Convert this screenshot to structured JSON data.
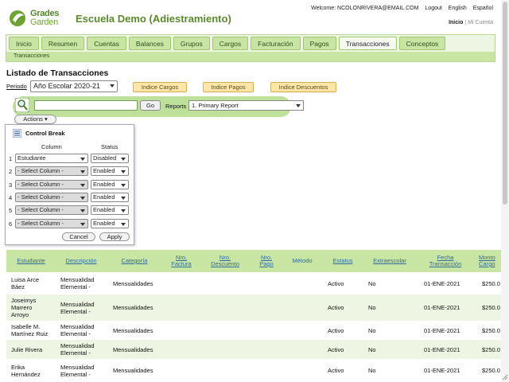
{
  "brand": {
    "line1": "Grades",
    "line2": "Garden",
    "colors": {
      "green": "#5a8a2a",
      "light_green": "#c9e5a4"
    }
  },
  "school_name": "Escuela Demo (Adiestramiento)",
  "top_links": {
    "welcome": "Welcome: NCOLONRIVERA@EMAIL.COM",
    "logout": "Logout",
    "english": "English",
    "espanol": "Español"
  },
  "account_links": {
    "inicio": "Inicio",
    "separator": "|",
    "mi_cuenta": "Mi Cuenta"
  },
  "tabs": [
    "Inicio",
    "Resumen",
    "Cuentas",
    "Balances",
    "Grupos",
    "Cargos",
    "Facturación",
    "Pagos",
    "Transacciones",
    "Conceptos"
  ],
  "active_tab": "Transacciones",
  "subnav": "Transacciones",
  "page_title": "Listado de Transacciones",
  "period": {
    "label": "Periodo",
    "value": "Año Escolar 2020-21"
  },
  "index_buttons": {
    "cargos": "Indice Cargos",
    "pagos": "Indice Pagos",
    "descuentos": "Indice Descuentos"
  },
  "search": {
    "go": "Go",
    "reports_label": "Reports",
    "report_selected": "1. Primary Report"
  },
  "actions_label": "Actions",
  "control_break": {
    "title": "Control Break",
    "column_header": "Column",
    "status_header": "Status",
    "rows": [
      {
        "num": "1",
        "column": "Estudiante",
        "status": "Disabled"
      },
      {
        "num": "2",
        "column": "- Select Column -",
        "status": "Enabled"
      },
      {
        "num": "3",
        "column": "- Select Column -",
        "status": "Enabled"
      },
      {
        "num": "4",
        "column": "- Select Column -",
        "status": "Enabled"
      },
      {
        "num": "5",
        "column": "- Select Column -",
        "status": "Enabled"
      },
      {
        "num": "6",
        "column": "- Select Column -",
        "status": "Enabled"
      }
    ],
    "cancel": "Cancel",
    "apply": "Apply"
  },
  "table": {
    "headers": {
      "estudiante": "Estudiante",
      "descripcion": "Descripción",
      "categoria": "Categoría",
      "nro_factura": [
        "Nro.",
        "Factura"
      ],
      "nro_descuento": [
        "Nro.",
        "Descuento"
      ],
      "nro_pago": [
        "Nro.",
        "Pago"
      ],
      "metodo": "Método",
      "estatus": "Estatus",
      "extraescolar": "Extraescolar",
      "fecha": [
        "Fecha",
        "Transacción"
      ],
      "monto": [
        "Monto",
        "Cargo"
      ]
    },
    "rows": [
      {
        "estudiante": [
          "Luisa Arce",
          "Báez"
        ],
        "descripcion": [
          "Mensualidad",
          "Elemental -"
        ],
        "categoria": "Mensualidades",
        "estatus": "Activo",
        "extraescolar": "No",
        "fecha": "01-ENE-2021",
        "monto": "$250.0"
      },
      {
        "estudiante": [
          "Joseimys",
          "Marrero",
          "Arroyo"
        ],
        "descripcion": [
          "Mensualidad",
          "Elemental -"
        ],
        "categoria": "Mensualidades",
        "estatus": "Activo",
        "extraescolar": "No",
        "fecha": "01-ENE-2021",
        "monto": "$250.0"
      },
      {
        "estudiante": [
          "Isabelle M.",
          "Martínez Ruiz"
        ],
        "descripcion": [
          "Mensualidad",
          "Elemental -"
        ],
        "categoria": "Mensualidades",
        "estatus": "Activo",
        "extraescolar": "No",
        "fecha": "01-ENE-2021",
        "monto": "$250.0"
      },
      {
        "estudiante": [
          "Julie Rivera"
        ],
        "descripcion": [
          "Mensualidad",
          "Elemental -"
        ],
        "categoria": "Mensualidades",
        "estatus": "Activo",
        "extraescolar": "No",
        "fecha": "01-ENE-2021",
        "monto": "$250.0"
      },
      {
        "estudiante": [
          "Erika",
          "Hernández"
        ],
        "descripcion": [
          "Mensualidad",
          "Elemental -"
        ],
        "categoria": "Mensualidades",
        "estatus": "Activo",
        "extraescolar": "No",
        "fecha": "01-ENE-2021",
        "monto": "$250.0"
      }
    ]
  }
}
